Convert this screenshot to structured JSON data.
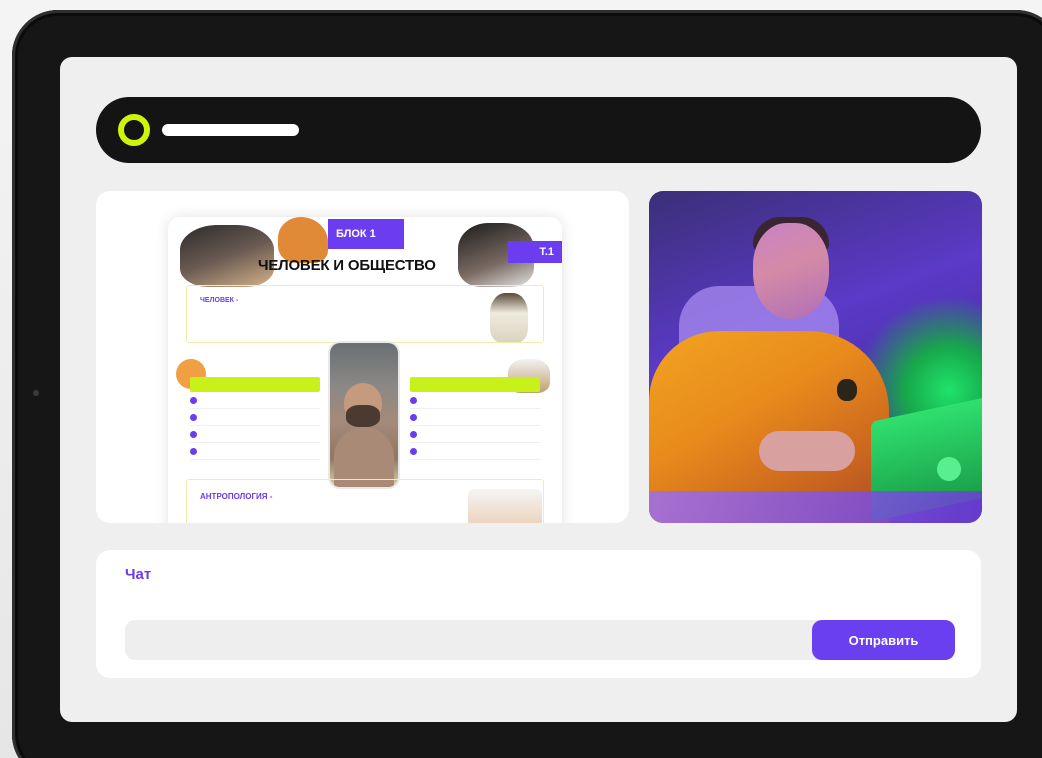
{
  "app": {
    "colors": {
      "accent": "#6a3ff0",
      "highlight": "#cff40a",
      "frame": "#161616",
      "screen_background": "#efefef"
    }
  },
  "topbar": {
    "icon": "ring-icon"
  },
  "slide": {
    "block_tag": "БЛОК 1",
    "topic_tag": "Т.1",
    "title": "ЧЕЛОВЕК И ОБЩЕСТВО",
    "section_person_label": "ЧЕЛОВЕК -",
    "section_anthropology_label": "АНТРОПОЛОГИЯ -"
  },
  "video": {
    "subject": "presenter-video"
  },
  "chat": {
    "title": "Чат",
    "input_value": "",
    "send_label": "Отправить"
  }
}
